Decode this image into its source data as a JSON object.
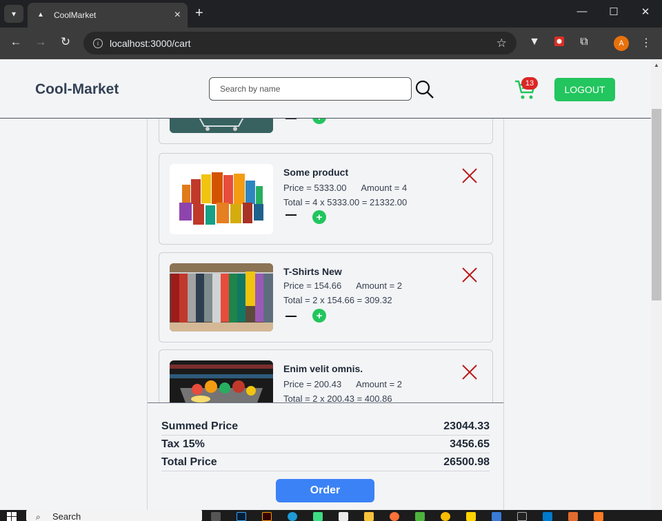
{
  "browser": {
    "tab_title": "CoolMarket",
    "url": "localhost:3000/cart",
    "profile_initial": "A"
  },
  "header": {
    "brand": "Cool-Market",
    "search_placeholder": "Search by name",
    "cart_count": "13",
    "logout_label": "LOGOUT"
  },
  "cart": {
    "items": [
      {
        "name": "Some product",
        "price_line": "Price = 5333.00      Amount = 4",
        "total_line": "Total = 4 x 5333.00 = 21332.00",
        "image": "groceries-products"
      },
      {
        "name": "T-Shirts New",
        "price_line": "Price = 154.66      Amount = 2",
        "total_line": "Total = 2 x 154.66 = 309.32",
        "image": "clothing-rack"
      },
      {
        "name": "Enim velit omnis.",
        "price_line": "Price = 200.43      Amount = 2",
        "total_line": "Total = 2 x 200.43 = 400.86",
        "image": "grocery-basket"
      }
    ]
  },
  "summary": {
    "summed_label": "Summed Price",
    "summed_value": "23044.33",
    "tax_label": "Tax 15%",
    "tax_value": "3456.65",
    "total_label": "Total Price",
    "total_value": "26500.98",
    "order_label": "Order"
  },
  "taskbar": {
    "search_label": "Search"
  },
  "colors": {
    "accent_green": "#22c55e",
    "accent_blue": "#3b82f6",
    "remove_red": "#b91c1c",
    "badge_red": "#dc2626"
  }
}
